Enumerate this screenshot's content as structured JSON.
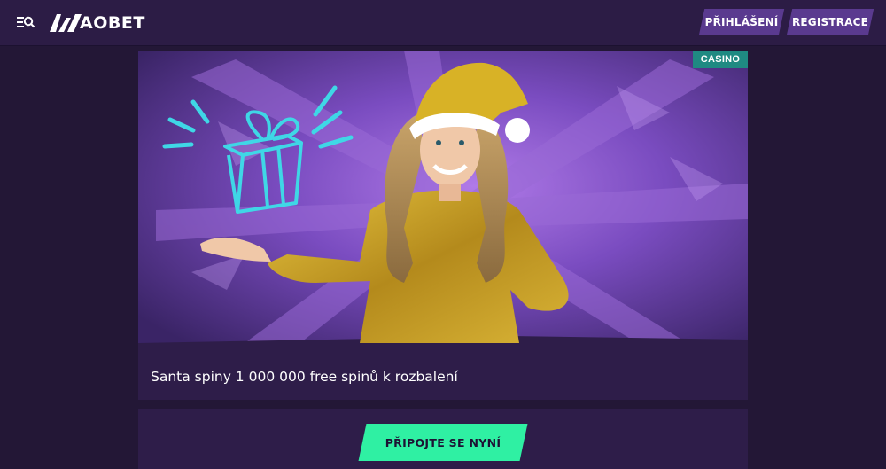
{
  "header": {
    "menu_icon": "menu-search-icon",
    "logo_text": "AOBET",
    "login_label": "PŘIHLÁŠENÍ",
    "register_label": "REGISTRACE"
  },
  "banner": {
    "badge": "CASINO",
    "title": "Santa spiny 1 000 000 free spinů k rozbalení",
    "image_icon": "promo-gift-icon"
  },
  "cta": {
    "label": "PŘIPOJTE SE NYNÍ"
  },
  "colors": {
    "page_bg": "#231736",
    "header_bg": "#2c1c45",
    "header_button": "#5a3a8f",
    "card_bg": "#2e1d49",
    "badge": "#1f8a82",
    "cta": "#2ff0a3",
    "gift_outline": "#3fd7e6"
  }
}
